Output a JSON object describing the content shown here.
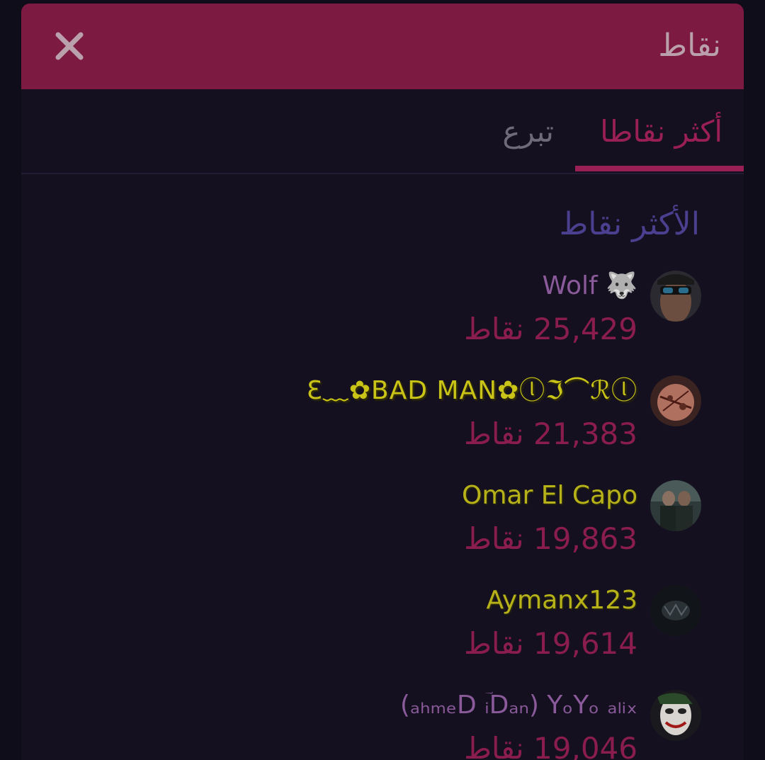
{
  "header": {
    "title": "نقاط"
  },
  "tabs": [
    {
      "label": "أكثر نقاطا",
      "active": true
    },
    {
      "label": "تبرع",
      "active": false
    }
  ],
  "section_title": "الأكثر نقاط",
  "leaderboard": [
    {
      "name": "Wolf 🐺",
      "points": "25,429",
      "points_unit": "نقاط",
      "name_color": "#8a5a9a"
    },
    {
      "name": "Ɛ︎﹏✿BAD MAN✿ⓛℑ⌒ℛⓛ",
      "points": "21,383",
      "points_unit": "نقاط",
      "name_color": "#c9c417"
    },
    {
      "name": "Omar El Capo",
      "points": "19,863",
      "points_unit": "نقاط",
      "name_color": "#b8b21a"
    },
    {
      "name": "Aymanx123",
      "points": "19,614",
      "points_unit": "نقاط",
      "name_color": "#b8b21a"
    },
    {
      "name": "(ₐₕₘₑD ؔᵢDₐₙ) YₒYₒ ₐₗᵢₓ",
      "points": "19,046",
      "points_unit": "نقاط",
      "name_color": "#8a5a9a"
    }
  ],
  "colors": {
    "accent": "#9a1f55",
    "header_bg": "#7c1a41",
    "background": "#14101f"
  }
}
